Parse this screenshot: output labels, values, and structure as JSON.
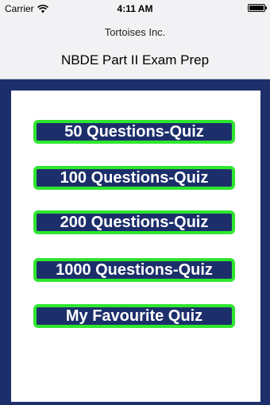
{
  "status_bar": {
    "carrier": "Carrier",
    "time": "4:11 AM",
    "wifi_icon": "wifi-icon",
    "battery_icon": "battery-icon"
  },
  "header": {
    "company": "Tortoises Inc.",
    "title": "NBDE Part II Exam Prep"
  },
  "menu": {
    "buttons": [
      {
        "label": "50 Questions-Quiz"
      },
      {
        "label": "100 Questions-Quiz"
      },
      {
        "label": "200 Questions-Quiz"
      },
      {
        "label": "1000 Questions-Quiz"
      },
      {
        "label": "My Favourite Quiz"
      }
    ]
  },
  "colors": {
    "background": "#1c2f6b",
    "button_border": "#2ee62e",
    "button_fill": "#1c2f6b",
    "panel": "#ffffff"
  }
}
